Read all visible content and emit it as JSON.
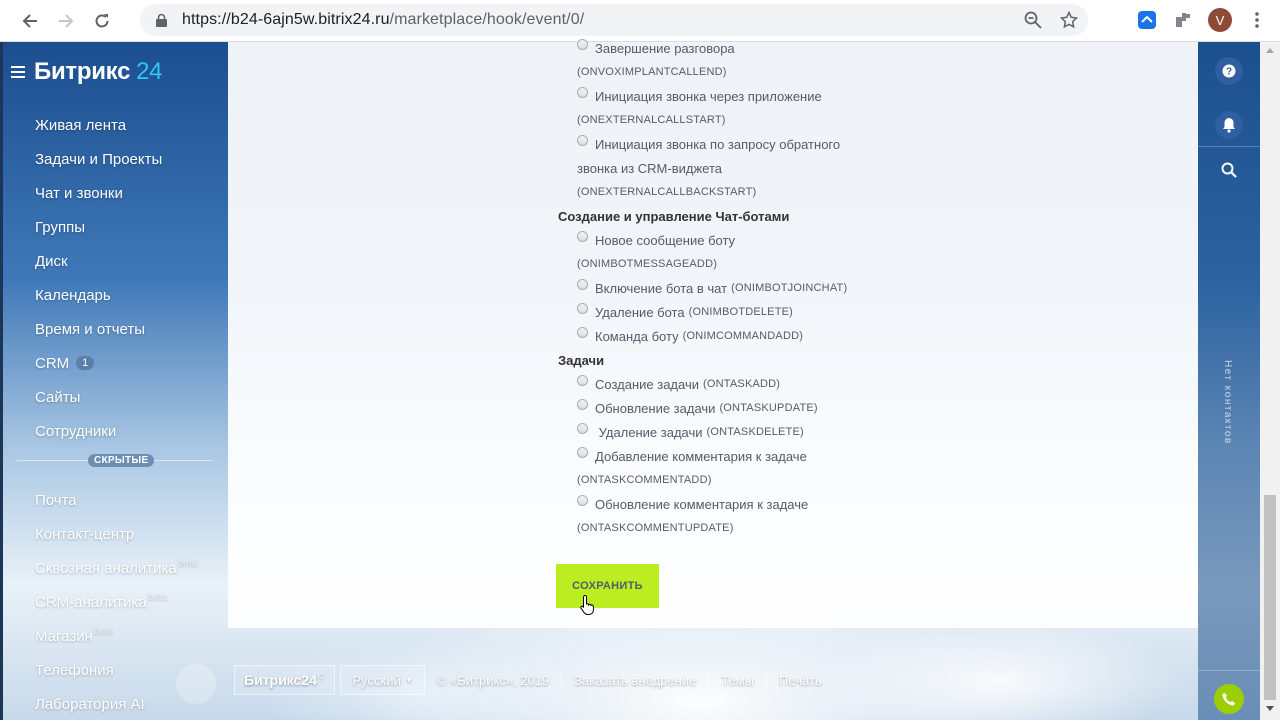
{
  "browser": {
    "url_host": "https://b24-6ajn5w.bitrix24.ru",
    "url_path": "/marketplace/hook/event/0/",
    "profile_initial": "V"
  },
  "sidebar": {
    "logo_text": "Битрикс",
    "logo_num": "24",
    "items": [
      {
        "label": "Живая лента"
      },
      {
        "label": "Задачи и Проекты"
      },
      {
        "label": "Чат и звонки"
      },
      {
        "label": "Группы"
      },
      {
        "label": "Диск"
      },
      {
        "label": "Календарь"
      },
      {
        "label": "Время и отчеты"
      },
      {
        "label": "CRM",
        "counter": "1"
      },
      {
        "label": "Сайты"
      },
      {
        "label": "Сотрудники"
      }
    ],
    "hidden_label": "СКРЫТЫЕ",
    "hidden_items": [
      {
        "label": "Почта"
      },
      {
        "label": "Контакт-центр"
      },
      {
        "label": "Сквозная аналитика",
        "sup": "beta"
      },
      {
        "label": "CRM-аналитика",
        "sup": "beta"
      },
      {
        "label": "Магазин",
        "sup": "beta"
      },
      {
        "label": "Телефония"
      },
      {
        "label": "Лаборатория AI"
      }
    ]
  },
  "form": {
    "rows": [
      {
        "kind": "radio",
        "text": "Завершение разговора",
        "code": ""
      },
      {
        "kind": "code",
        "text": "",
        "code": "(ONVOXIMPLANTCALLEND)"
      },
      {
        "kind": "radio",
        "text": "Инициация звонка через приложение",
        "code": ""
      },
      {
        "kind": "code",
        "text": "",
        "code": "(ONEXTERNALCALLSTART)"
      },
      {
        "kind": "radio",
        "text": "Инициация звонка по запросу обратного",
        "code": ""
      },
      {
        "kind": "text",
        "text": "звонка из CRM-виджета",
        "code": ""
      },
      {
        "kind": "code",
        "text": "",
        "code": "(ONEXTERNALCALLBACKSTART)"
      },
      {
        "kind": "group",
        "text": "Создание и управление Чат-ботами",
        "code": ""
      },
      {
        "kind": "radio",
        "text": "Новое сообщение боту",
        "code": ""
      },
      {
        "kind": "code",
        "text": "",
        "code": "(ONIMBOTMESSAGEADD)"
      },
      {
        "kind": "radio",
        "text": "Включение бота в чат",
        "code": "(ONIMBOTJOINCHAT)"
      },
      {
        "kind": "radio",
        "text": "Удаление бота",
        "code": "(ONIMBOTDELETE)"
      },
      {
        "kind": "radio",
        "text": "Команда боту",
        "code": "(ONIMCOMMANDADD)"
      },
      {
        "kind": "group",
        "text": "Задачи",
        "code": ""
      },
      {
        "kind": "radio",
        "text": "Создание задачи",
        "code": "(ONTASKADD)"
      },
      {
        "kind": "radio",
        "text": "Обновление задачи",
        "code": "(ONTASKUPDATE)"
      },
      {
        "kind": "radio",
        "text": " Удаление задачи",
        "code": "(ONTASKDELETE)"
      },
      {
        "kind": "radio",
        "text": "Добавление комментария к задаче",
        "code": ""
      },
      {
        "kind": "code",
        "text": "",
        "code": "(ONTASKCOMMENTADD)"
      },
      {
        "kind": "radio",
        "text": "Обновление комментария к задаче",
        "code": ""
      },
      {
        "kind": "code",
        "text": "",
        "code": "(ONTASKCOMMENTUPDATE)"
      }
    ],
    "save_label": "СОХРАНИТЬ"
  },
  "rail": {
    "no_contacts": "Нет контактов"
  },
  "footer": {
    "logo": "Битрикс24",
    "logo_mark": "©",
    "language": "Русский",
    "copyright": "© «Битрикс», 2019",
    "links": [
      "Заказать внедрение",
      "Темы",
      "Печать"
    ]
  },
  "colors": {
    "accent": "#2fc6f6",
    "save_button": "#bbed21",
    "phone": "#9dcf00"
  }
}
